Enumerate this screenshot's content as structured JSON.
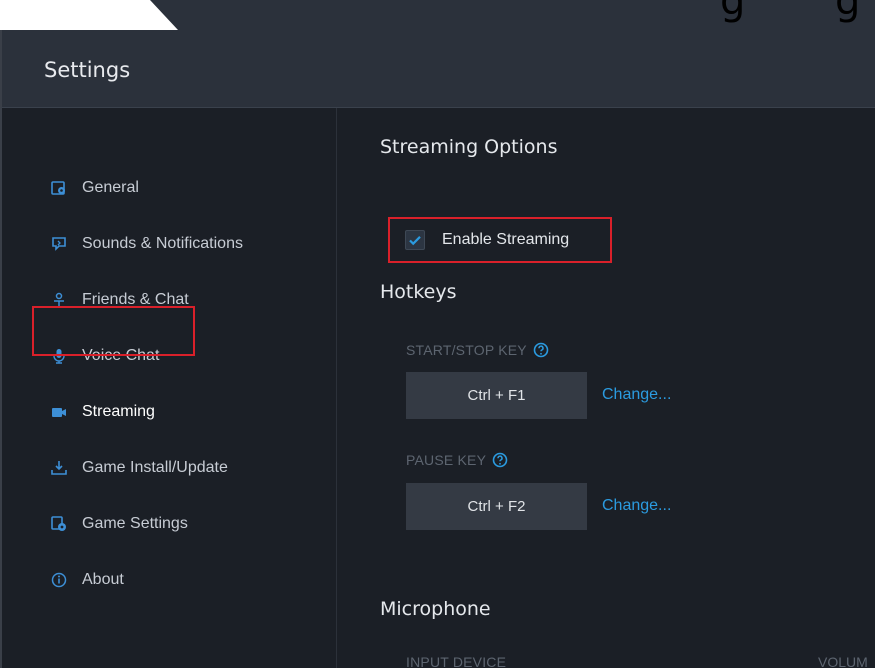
{
  "top_crop_glyphs": [
    "g",
    "g"
  ],
  "header": {
    "title": "Settings"
  },
  "sidebar": {
    "items": [
      {
        "label": "General",
        "icon": "gear-square-icon",
        "active": false
      },
      {
        "label": "Sounds & Notifications",
        "icon": "chat-bubble-icon",
        "active": false
      },
      {
        "label": "Friends & Chat",
        "icon": "friends-icon",
        "active": false
      },
      {
        "label": "Voice Chat",
        "icon": "microphone-icon",
        "active": false
      },
      {
        "label": "Streaming",
        "icon": "video-camera-icon",
        "active": true
      },
      {
        "label": "Game Install/Update",
        "icon": "download-icon",
        "active": false
      },
      {
        "label": "Game Settings",
        "icon": "game-gear-icon",
        "active": false
      },
      {
        "label": "About",
        "icon": "info-icon",
        "active": false
      }
    ]
  },
  "content": {
    "streaming_options_title": "Streaming Options",
    "enable_streaming": {
      "label": "Enable Streaming",
      "checked": true
    },
    "hotkeys_title": "Hotkeys",
    "start_stop": {
      "label": "START/STOP KEY",
      "value": "Ctrl + F1",
      "change": "Change..."
    },
    "pause": {
      "label": "PAUSE KEY",
      "value": "Ctrl + F2",
      "change": "Change..."
    },
    "microphone_title": "Microphone",
    "input_device_label": "INPUT DEVICE",
    "volume_label": "VOLUM"
  },
  "colors": {
    "accent": "#2b9be0",
    "highlight": "#d9202a",
    "background": "#1b1f26",
    "header": "#2b313b"
  }
}
